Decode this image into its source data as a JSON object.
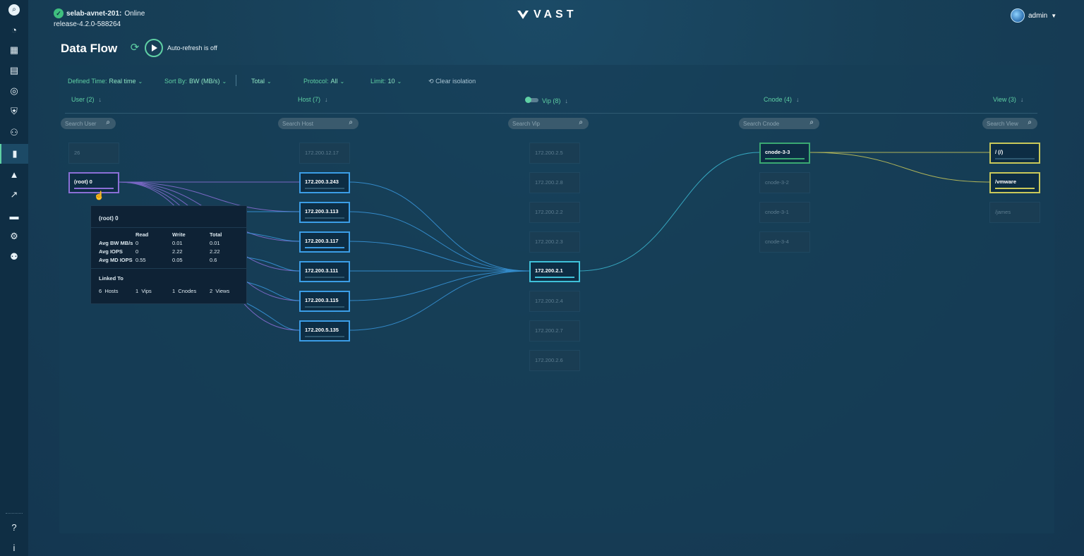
{
  "cluster": {
    "name": "selab-avnet-201:",
    "status": "Online",
    "release": "release-4.2.0-588264"
  },
  "logo": {
    "text": "VAST"
  },
  "user_menu": {
    "name": "admin"
  },
  "sidebar": {
    "items": [
      {
        "name": "search-icon",
        "glyph": "⌕"
      },
      {
        "name": "dashboard-icon",
        "glyph": "◔"
      },
      {
        "name": "storage-icon",
        "glyph": "▦"
      },
      {
        "name": "element-store-icon",
        "glyph": "▤"
      },
      {
        "name": "network-icon",
        "glyph": "◎"
      },
      {
        "name": "security-icon",
        "glyph": "⛨"
      },
      {
        "name": "users-icon",
        "glyph": "⚇"
      },
      {
        "name": "analytics-icon",
        "glyph": "▮"
      },
      {
        "name": "alerts-icon",
        "glyph": "▲"
      },
      {
        "name": "trends-icon",
        "glyph": "↗"
      },
      {
        "name": "hardware-icon",
        "glyph": "▬"
      },
      {
        "name": "settings-icon",
        "glyph": "⚙"
      },
      {
        "name": "admin-settings-icon",
        "glyph": "⚉"
      }
    ],
    "help": "?",
    "info": "i"
  },
  "page": {
    "title": "Data Flow",
    "auto_refresh": "Auto-refresh is off"
  },
  "filters": {
    "defined_time_label": "Defined Time:",
    "defined_time_value": "Real time",
    "sort_by_label": "Sort By:",
    "sort_by_value": "BW (MB/s)",
    "total": "Total",
    "protocol_label": "Protocol:",
    "protocol_value": "All",
    "limit_label": "Limit:",
    "limit_value": "10",
    "clear_isolation": "Clear isolation"
  },
  "columns": {
    "user": "User (2)",
    "host": "Host (7)",
    "vip": "Vip (8)",
    "cnode": "Cnode (4)",
    "view": "View (3)"
  },
  "search": {
    "user": "Search User",
    "host": "Search Host",
    "vip": "Search Vip",
    "cnode": "Search Cnode",
    "view": "Search View"
  },
  "nodes": {
    "users": [
      "26",
      "(root) 0"
    ],
    "hosts": [
      "172.200.12.17",
      "172.200.3.243",
      "172.200.3.113",
      "172.200.3.117",
      "172.200.3.111",
      "172.200.3.115",
      "172.200.5.135"
    ],
    "vips": [
      "172.200.2.5",
      "172.200.2.8",
      "172.200.2.2",
      "172.200.2.3",
      "172.200.2.1",
      "172.200.2.4",
      "172.200.2.7",
      "172.200.2.6"
    ],
    "cnodes": [
      "cnode-3-3",
      "cnode-3-2",
      "cnode-3-1",
      "cnode-3-4"
    ],
    "views": [
      "/ (/)",
      "/vmware",
      "/james"
    ]
  },
  "colors": {
    "accent": "#5fd0a4",
    "user_link": "#8a6fd6",
    "host_link": "#3b9de6",
    "vip_link": "#3fc1d9",
    "cnode_link": "#3aa872",
    "view_link": "#c9c85a"
  },
  "tooltip": {
    "title": "(root) 0",
    "headers": [
      "Read",
      "Write",
      "Total"
    ],
    "rows": [
      {
        "label": "Avg BW MB/s",
        "read": "0",
        "write": "0.01",
        "total": "0.01"
      },
      {
        "label": "Avg IOPS",
        "read": "0",
        "write": "2.22",
        "total": "2.22"
      },
      {
        "label": "Avg MD IOPS",
        "read": "0.55",
        "write": "0.05",
        "total": "0.6"
      }
    ],
    "linked_to_label": "Linked To",
    "linked": [
      {
        "count": "6",
        "label": "Hosts"
      },
      {
        "count": "1",
        "label": "Vips"
      },
      {
        "count": "1",
        "label": "Cnodes"
      },
      {
        "count": "2",
        "label": "Views"
      }
    ]
  }
}
